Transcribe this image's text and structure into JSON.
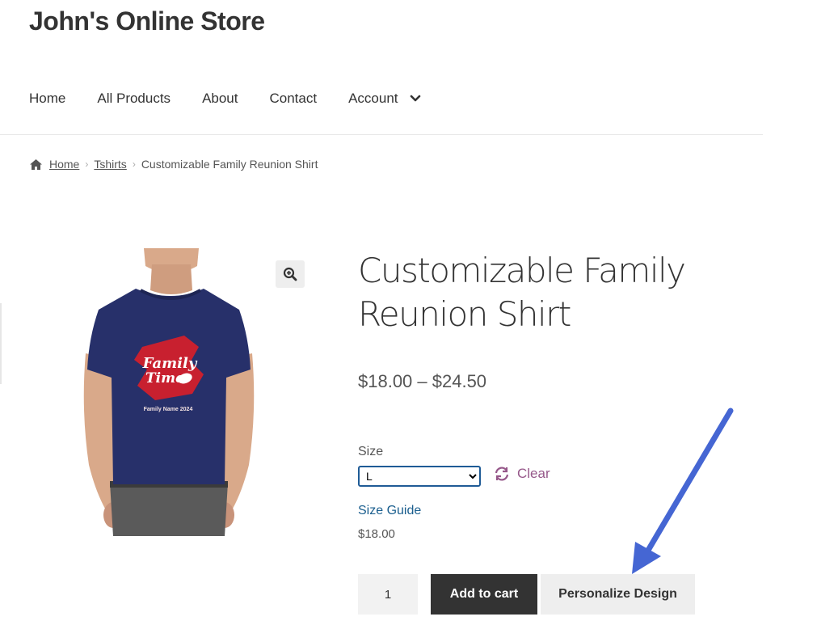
{
  "site": {
    "title": "John's Online Store"
  },
  "nav": {
    "items": [
      {
        "label": "Home"
      },
      {
        "label": "All Products"
      },
      {
        "label": "About"
      },
      {
        "label": "Contact"
      },
      {
        "label": "Account"
      }
    ],
    "account_dropdown_icon": "chevron-down-icon"
  },
  "breadcrumb": {
    "home_icon": "home-icon",
    "home": "Home",
    "category": "Tshirts",
    "current": "Customizable Family Reunion Shirt"
  },
  "product": {
    "title": "Customizable Family Reunion Shirt",
    "price_range": "$18.00 – $24.50",
    "size_label": "Size",
    "size_selected": "L",
    "clear_label": "Clear",
    "size_guide": "Size Guide",
    "variation_price": "$18.00",
    "quantity": "1",
    "add_to_cart": "Add to cart",
    "personalize": "Personalize Design",
    "zoom_icon": "zoom-in-icon",
    "shirt_print": {
      "line1": "Family",
      "line2": "Time",
      "line3": "Family Name 2024"
    }
  },
  "colors": {
    "accent_purple": "#96588a",
    "link_blue": "#1a5e8e",
    "button_dark": "#333333",
    "arrow_blue": "#4566d3"
  }
}
